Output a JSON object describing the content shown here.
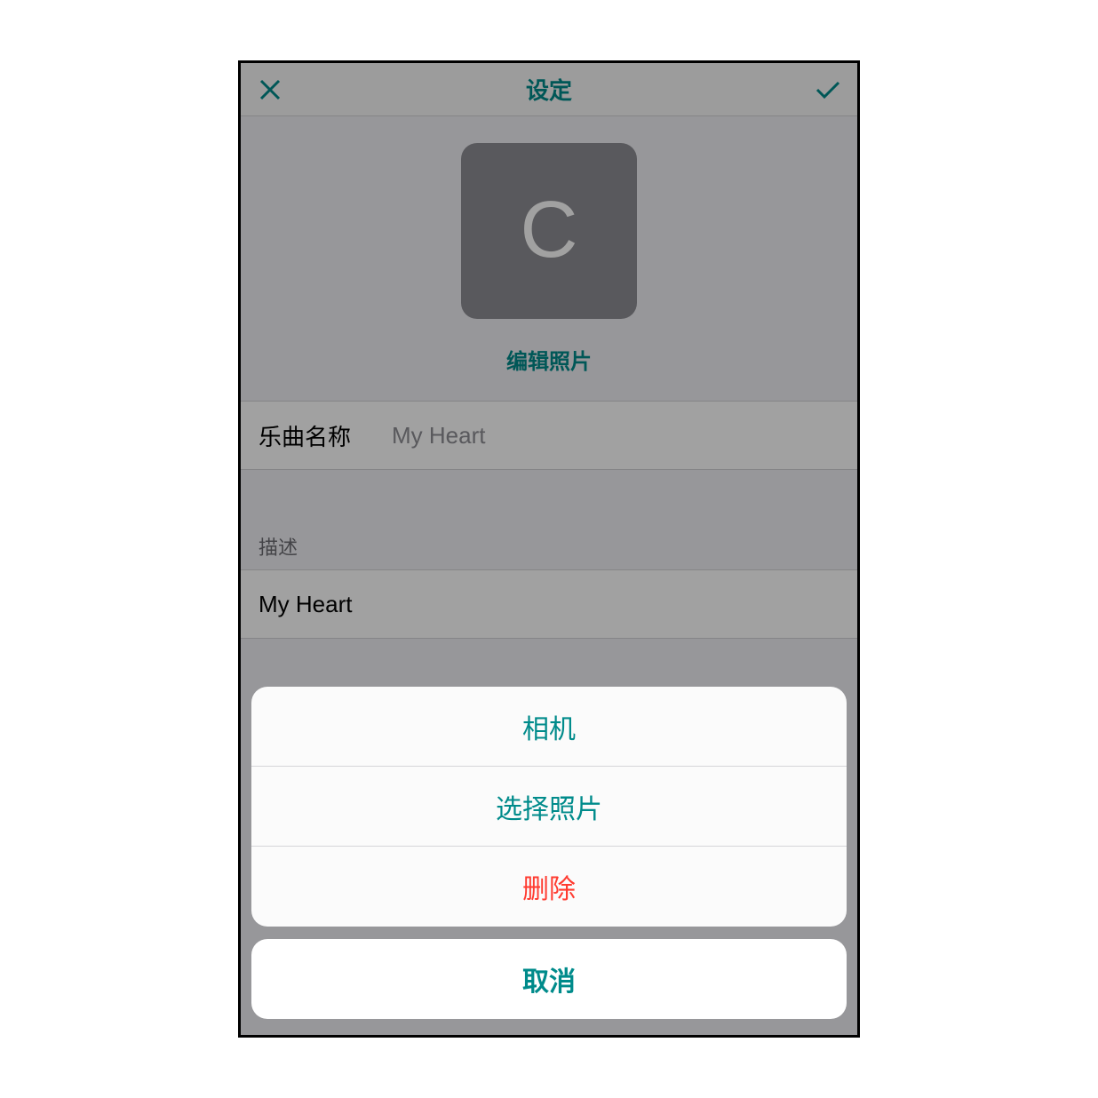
{
  "colors": {
    "accent": "#008b8b",
    "destructive": "#ff3b30"
  },
  "header": {
    "title": "设定",
    "close_icon": "close-icon",
    "confirm_icon": "check-icon"
  },
  "photo": {
    "initial": "C",
    "edit_label": "编辑照片"
  },
  "fields": {
    "song_name_label": "乐曲名称",
    "song_name_value": "My Heart",
    "description_label": "描述",
    "description_value": "My Heart"
  },
  "action_sheet": {
    "options": [
      {
        "label": "相机",
        "role": "default"
      },
      {
        "label": "选择照片",
        "role": "default"
      },
      {
        "label": "删除",
        "role": "destructive"
      }
    ],
    "cancel_label": "取消"
  }
}
